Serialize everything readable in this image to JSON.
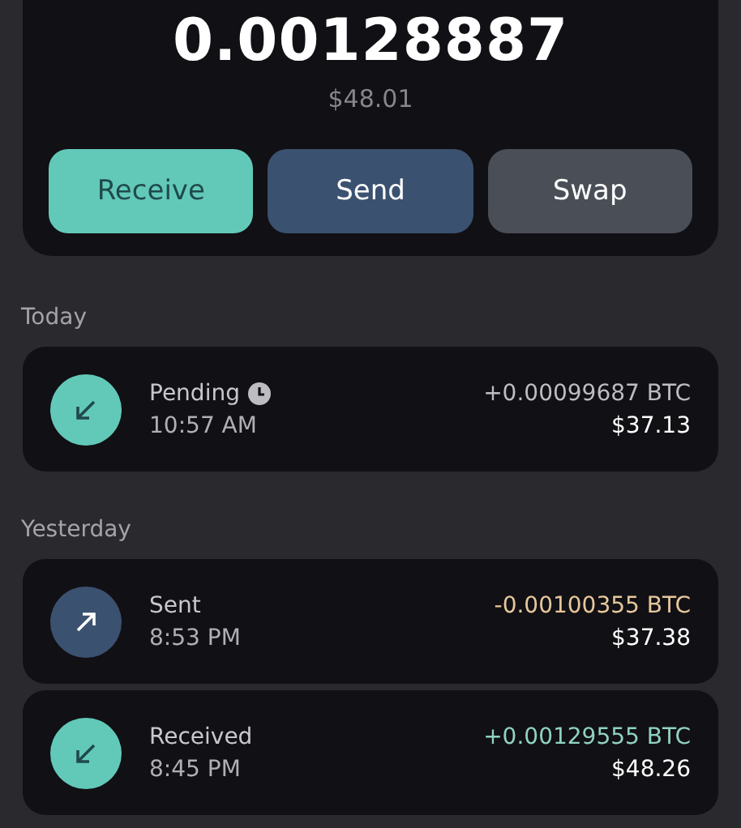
{
  "balance": {
    "amount": "0.00128887",
    "fiat": "$48.01"
  },
  "actions": [
    {
      "label": "Receive",
      "kind": "accent"
    },
    {
      "label": "Send",
      "kind": "primary"
    },
    {
      "label": "Swap",
      "kind": "neutral"
    }
  ],
  "sections": [
    {
      "label": "Today",
      "transactions": [
        {
          "kind": "receive",
          "title": "Pending",
          "pending": true,
          "time": "10:57 AM",
          "amount": "+0.00099687 BTC",
          "color": "#bdbcc0",
          "fiat": "$37.13"
        }
      ]
    },
    {
      "label": "Yesterday",
      "transactions": [
        {
          "kind": "send",
          "title": "Sent",
          "pending": false,
          "time": "8:53 PM",
          "amount": "-0.00100355 BTC",
          "color": "#e6c79c",
          "fiat": "$37.38"
        },
        {
          "kind": "receive",
          "title": "Received",
          "pending": false,
          "time": "8:45 PM",
          "amount": "+0.00129555 BTC",
          "color": "#8fd2bf",
          "fiat": "$48.26"
        }
      ]
    }
  ]
}
